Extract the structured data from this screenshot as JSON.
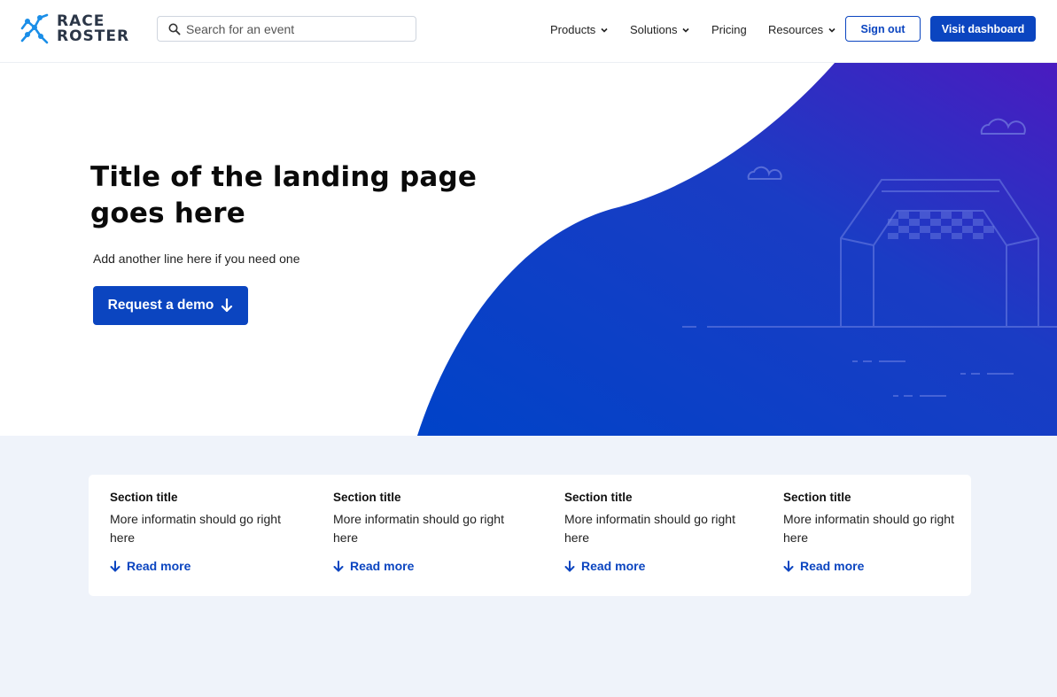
{
  "brand": {
    "line1": "RACE",
    "line2": "ROSTER",
    "colors": {
      "primary": "#0b45c0",
      "logo_node": "#1a8ee8"
    }
  },
  "search": {
    "placeholder": "Search for an event",
    "icon": "search-icon"
  },
  "nav": {
    "items": [
      {
        "label": "Products",
        "has_dropdown": true
      },
      {
        "label": "Solutions",
        "has_dropdown": true
      },
      {
        "label": "Pricing",
        "has_dropdown": false
      },
      {
        "label": "Resources",
        "has_dropdown": true
      }
    ],
    "sign_out": "Sign out",
    "visit_dashboard": "Visit dashboard"
  },
  "hero": {
    "title": "Title of the landing page goes here",
    "subtitle": "Add another line here if you need one",
    "cta": "Request a demo",
    "cta_icon": "arrow-down-icon"
  },
  "sections": [
    {
      "title": "Section title",
      "desc": "More informatin should go right here",
      "link": "Read more"
    },
    {
      "title": "Section title",
      "desc": "More informatin should go right here",
      "link": "Read more"
    },
    {
      "title": "Section title",
      "desc": "More informatin should go right here",
      "link": "Read more"
    },
    {
      "title": "Section title",
      "desc": "More informatin should go right here",
      "link": "Read more"
    }
  ]
}
